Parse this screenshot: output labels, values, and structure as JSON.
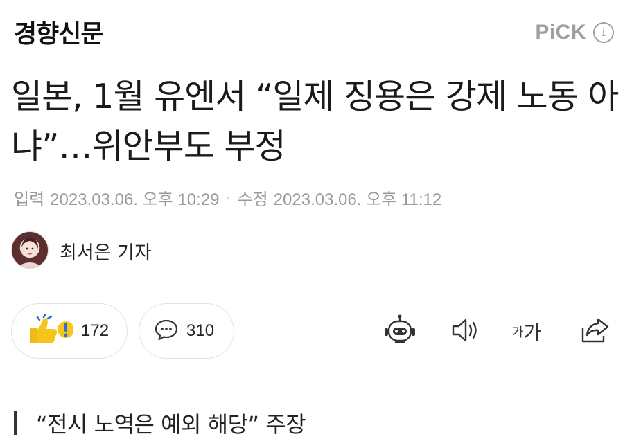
{
  "header": {
    "brand": "경향신문",
    "pick_label": "PiCK",
    "info_icon": "i"
  },
  "article": {
    "headline": "일본, 1월 유엔서 “일제 징용은 강제 노동 아냐”…위안부도 부정",
    "published_label": "입력",
    "published_at": "2023.03.06. 오후 10:29",
    "separator": "·",
    "modified_label": "수정",
    "modified_at": "2023.03.06. 오후 11:12",
    "reporter": "최서은 기자",
    "subheading": "“전시 노역은 예외 해당” 주장"
  },
  "actions": {
    "reaction_count": "172",
    "comment_count": "310",
    "font_size_small": "가",
    "font_size_large": "가"
  },
  "icons": {
    "reaction": "thumbs-up-icon",
    "comment": "speech-bubble-icon",
    "summary": "robot-icon",
    "tts": "speaker-icon",
    "share": "share-icon"
  },
  "colors": {
    "pick_gray": "#9aa0a6",
    "meta_gray": "#9a9a9a",
    "thumb_yellow": "#f5c518",
    "exclaim_blue": "#2d6cdf"
  }
}
